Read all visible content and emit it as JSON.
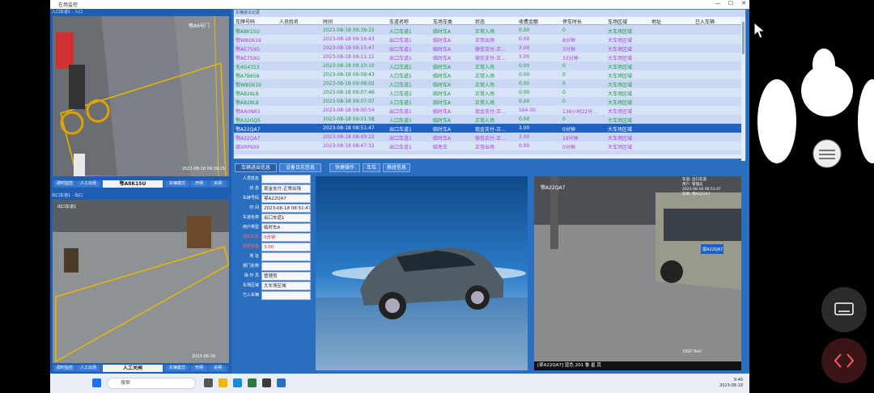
{
  "window": {
    "title": "在场监控",
    "min": "—",
    "max": "☐",
    "close": "✕"
  },
  "cameras": [
    {
      "header": "入口车道1 - 入口",
      "overlay_name": "鄂A6号门",
      "timestamp": "2023-08-18 09:39:25",
      "buttons": [
        "即时监控",
        "人工出场"
      ],
      "plate": "鄂A8K15U",
      "right_buttons": [
        "车辆模式",
        "开闸",
        "关闸"
      ]
    },
    {
      "header": "出口车道1 - 出口",
      "overlay_name": "出口车道1",
      "timestamp": "2023-08-18",
      "buttons": [
        "即时监控",
        "人工出场"
      ],
      "plate": "人工关闸",
      "right_buttons": [
        "车辆模式",
        "开闸",
        "关闸"
      ]
    }
  ],
  "records": {
    "panel_label": "车辆进出记录",
    "columns": [
      "车牌号码",
      "人员姓名",
      "时间",
      "车道名称",
      "车场车类",
      "状态",
      "收费金额",
      "停车时长",
      "车场区域",
      "地址",
      "已入车辆"
    ],
    "rows": [
      [
        "鄂A8K15U",
        "",
        "2023-08-18 09:39:25",
        "入口车道1",
        "临时车A",
        "正常入场",
        "0.00",
        "0",
        "大车场区域"
      ],
      [
        "鄂W8G619",
        "",
        "2023-08-18 09:16:43",
        "出口车道1",
        "临时车A",
        "正常出场",
        "0.00",
        "8分钟",
        "大车场区域"
      ],
      [
        "鄂AE759G",
        "",
        "2023-08-18 09:15:47",
        "出口车道1",
        "临时车A",
        "微信支付-正…",
        "3.00",
        "3分钟",
        "大车场区域"
      ],
      [
        "鄂AE759G",
        "",
        "2023-08-18 09:11:11",
        "出口车道1",
        "临时车A",
        "微信支付-正…",
        "3.00",
        "33分钟",
        "大车场区域"
      ],
      [
        "无4G4313",
        "",
        "2023-08-18 09:10:10",
        "入口车道1",
        "临时车A",
        "正常入场",
        "0.00",
        "0",
        "大车场区域"
      ],
      [
        "鄂A7B658",
        "",
        "2023-08-18 09:09:43",
        "入口车道1",
        "临时车A",
        "正常入场",
        "0.00",
        "0",
        "大车场区域"
      ],
      [
        "鄂W8G619",
        "",
        "2023-08-18 09:08:02",
        "入口车道1",
        "临时车A",
        "正常入场",
        "0.00",
        "0",
        "大车场区域"
      ],
      [
        "鄂A828L8",
        "",
        "2023-08-18 09:07:46",
        "入口车道1",
        "临时车A",
        "正常入场",
        "0.00",
        "0",
        "大车场区域"
      ],
      [
        "鄂A828L8",
        "",
        "2023-08-18 09:07:07",
        "入口车道1",
        "临时车A",
        "正常入场",
        "0.00",
        "0",
        "大车场区域"
      ],
      [
        "鄂AA0N63",
        "",
        "2023-08-18 09:00:54",
        "出口车道1",
        "临时车A",
        "现金支付-正…",
        "164.00",
        "136小时22分…",
        "大车场区域"
      ],
      [
        "鄂A32GQ5",
        "",
        "2023-08-18 09:01:58",
        "入口车道1",
        "临时车A",
        "正常入场",
        "0.00",
        "0",
        "大车场区域"
      ],
      [
        "鄂A22QA7",
        "",
        "2023-08-18 08:51:47",
        "出口车道1",
        "临时车A",
        "现金支付-正…",
        "3.00",
        "0分钟",
        "大车场区域"
      ],
      [
        "鄂A22QA7",
        "",
        "2023-08-18 08:49:22",
        "出口车道1",
        "临时车A",
        "微信支付-正…",
        "3.00",
        "19分钟",
        "大车场区域"
      ],
      [
        "赣XRP900",
        "",
        "2023-08-18 08:47:32",
        "出口车道1",
        "临免车",
        "正常出场",
        "0.00",
        "0分钟",
        "大车场区域"
      ]
    ]
  },
  "tabs": [
    "车辆进出信息",
    "设备日志信息",
    "快捷操作",
    "车位",
    "换班信息"
  ],
  "detail": {
    "fields": [
      {
        "label": "人员姓名",
        "value": "",
        "red": false
      },
      {
        "label": "状 态",
        "value": "现金支付-正常出场",
        "red": false
      },
      {
        "label": "车牌号码",
        "value": "鄂A22QA7",
        "red": false
      },
      {
        "label": "时 间",
        "value": "2023-08-18 08:51:47",
        "red": false
      },
      {
        "label": "车道名称",
        "value": "出口车道1",
        "red": false
      },
      {
        "label": "用户类型",
        "value": "临时车A",
        "red": false
      },
      {
        "label": "停车时长",
        "value": "0分钟",
        "red": true
      },
      {
        "label": "收费金额",
        "value": "3.00",
        "red": true
      },
      {
        "label": "地 址",
        "value": "",
        "red": false
      },
      {
        "label": "部门名称",
        "value": "",
        "red": false
      },
      {
        "label": "操 作 员",
        "value": "管理员",
        "red": false
      },
      {
        "label": "车场区域",
        "value": "大车场区域",
        "red": false
      },
      {
        "label": "已入车辆",
        "value": "",
        "red": false
      }
    ]
  },
  "snapshot": {
    "overlay": [
      "车道: 出口车道",
      "用户: 管理员",
      "2023-08-18 08:51:47",
      "车牌: 鄂A22QA7"
    ],
    "caption": "[鄂A22QA7] 蓝色 201 鲁 星 其",
    "osd": "OSD Text",
    "plate_small": "鄂A22QA7"
  },
  "taskbar": {
    "search_placeholder": "搜索",
    "time": "9:46",
    "date": "2023-08-18"
  },
  "colors": {
    "app_bg": "#2a6fbf",
    "selected_row": "#1d62c6",
    "purple_text": "#b13bd6",
    "green_text": "#1a9c3a"
  }
}
